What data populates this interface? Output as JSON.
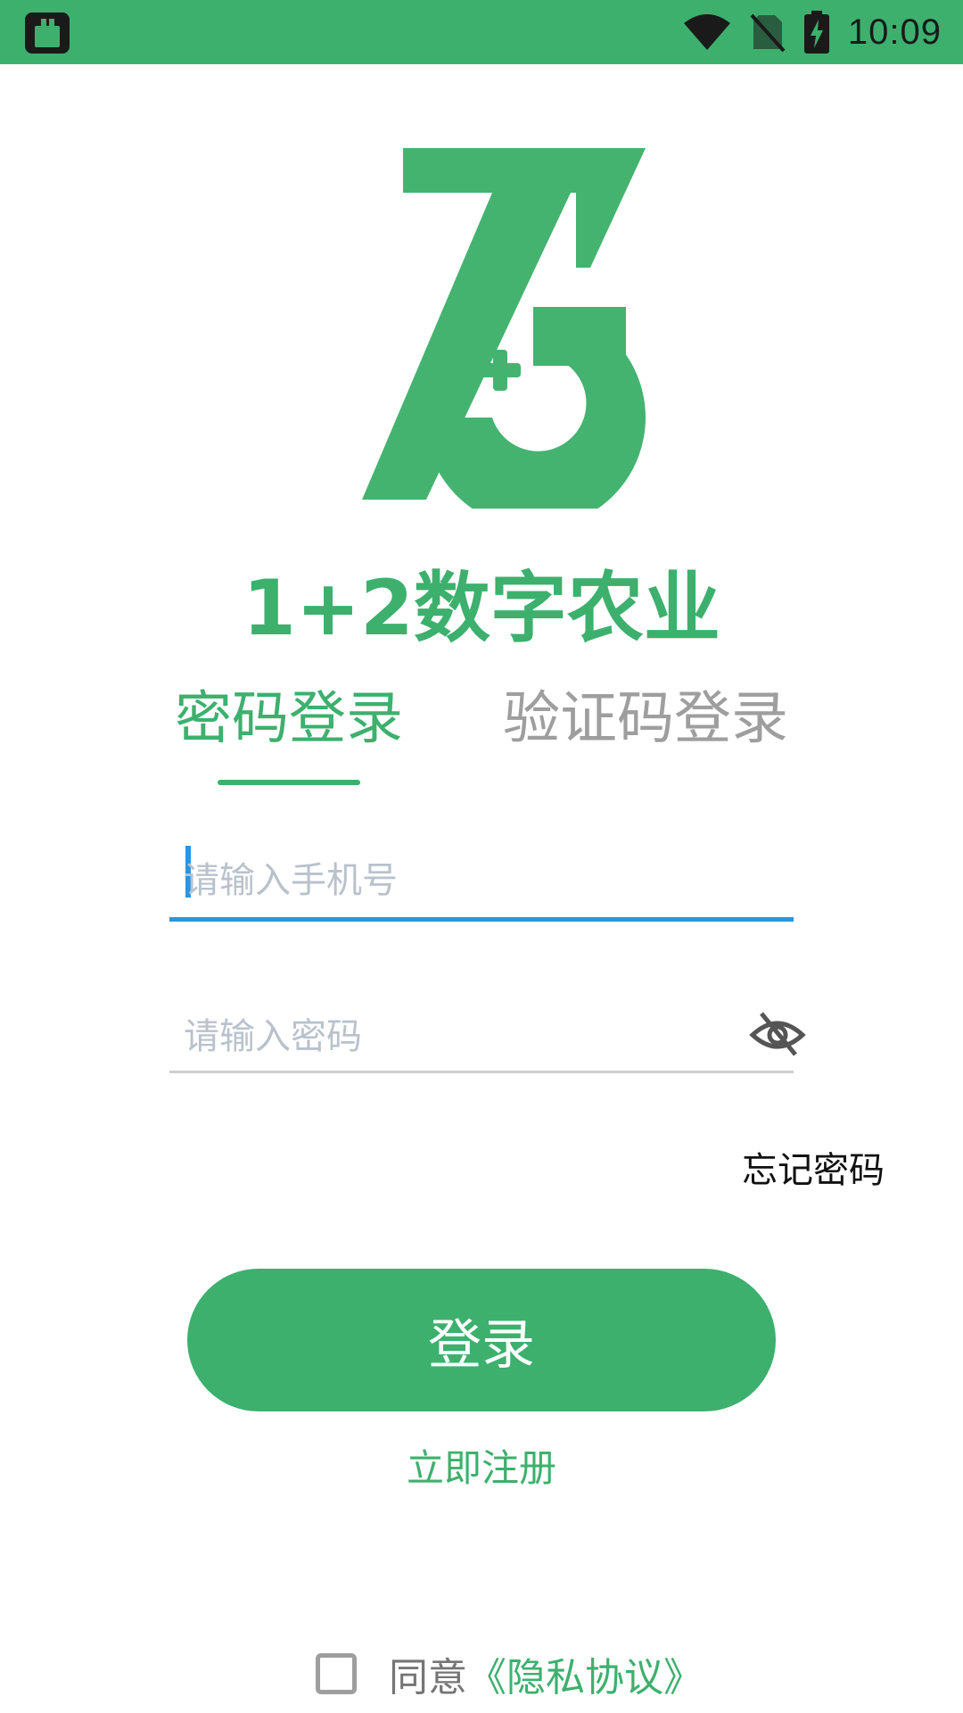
{
  "status_bar": {
    "time": "10:09",
    "app_icon": "clipboard-app-icon",
    "wifi_icon": "wifi-icon",
    "no_sim_icon": "no-sim-icon",
    "battery_icon": "battery-charging-icon"
  },
  "brand": {
    "logo_icon": "brand-logo-icon",
    "app_name": "1+2数字农业",
    "accent_color": "#3db06e"
  },
  "tabs": [
    {
      "label": "密码登录",
      "active": true
    },
    {
      "label": "验证码登录",
      "active": false
    }
  ],
  "form": {
    "phone_placeholder": "请输入手机号",
    "phone_value": "",
    "password_placeholder": "请输入密码",
    "password_value": "",
    "password_toggle_icon": "eye-off-icon",
    "forgot_label": "忘记密码",
    "login_label": "登录",
    "register_label": "立即注册"
  },
  "agreement": {
    "checked": false,
    "prefix": "同意",
    "link": "《隐私协议》"
  }
}
